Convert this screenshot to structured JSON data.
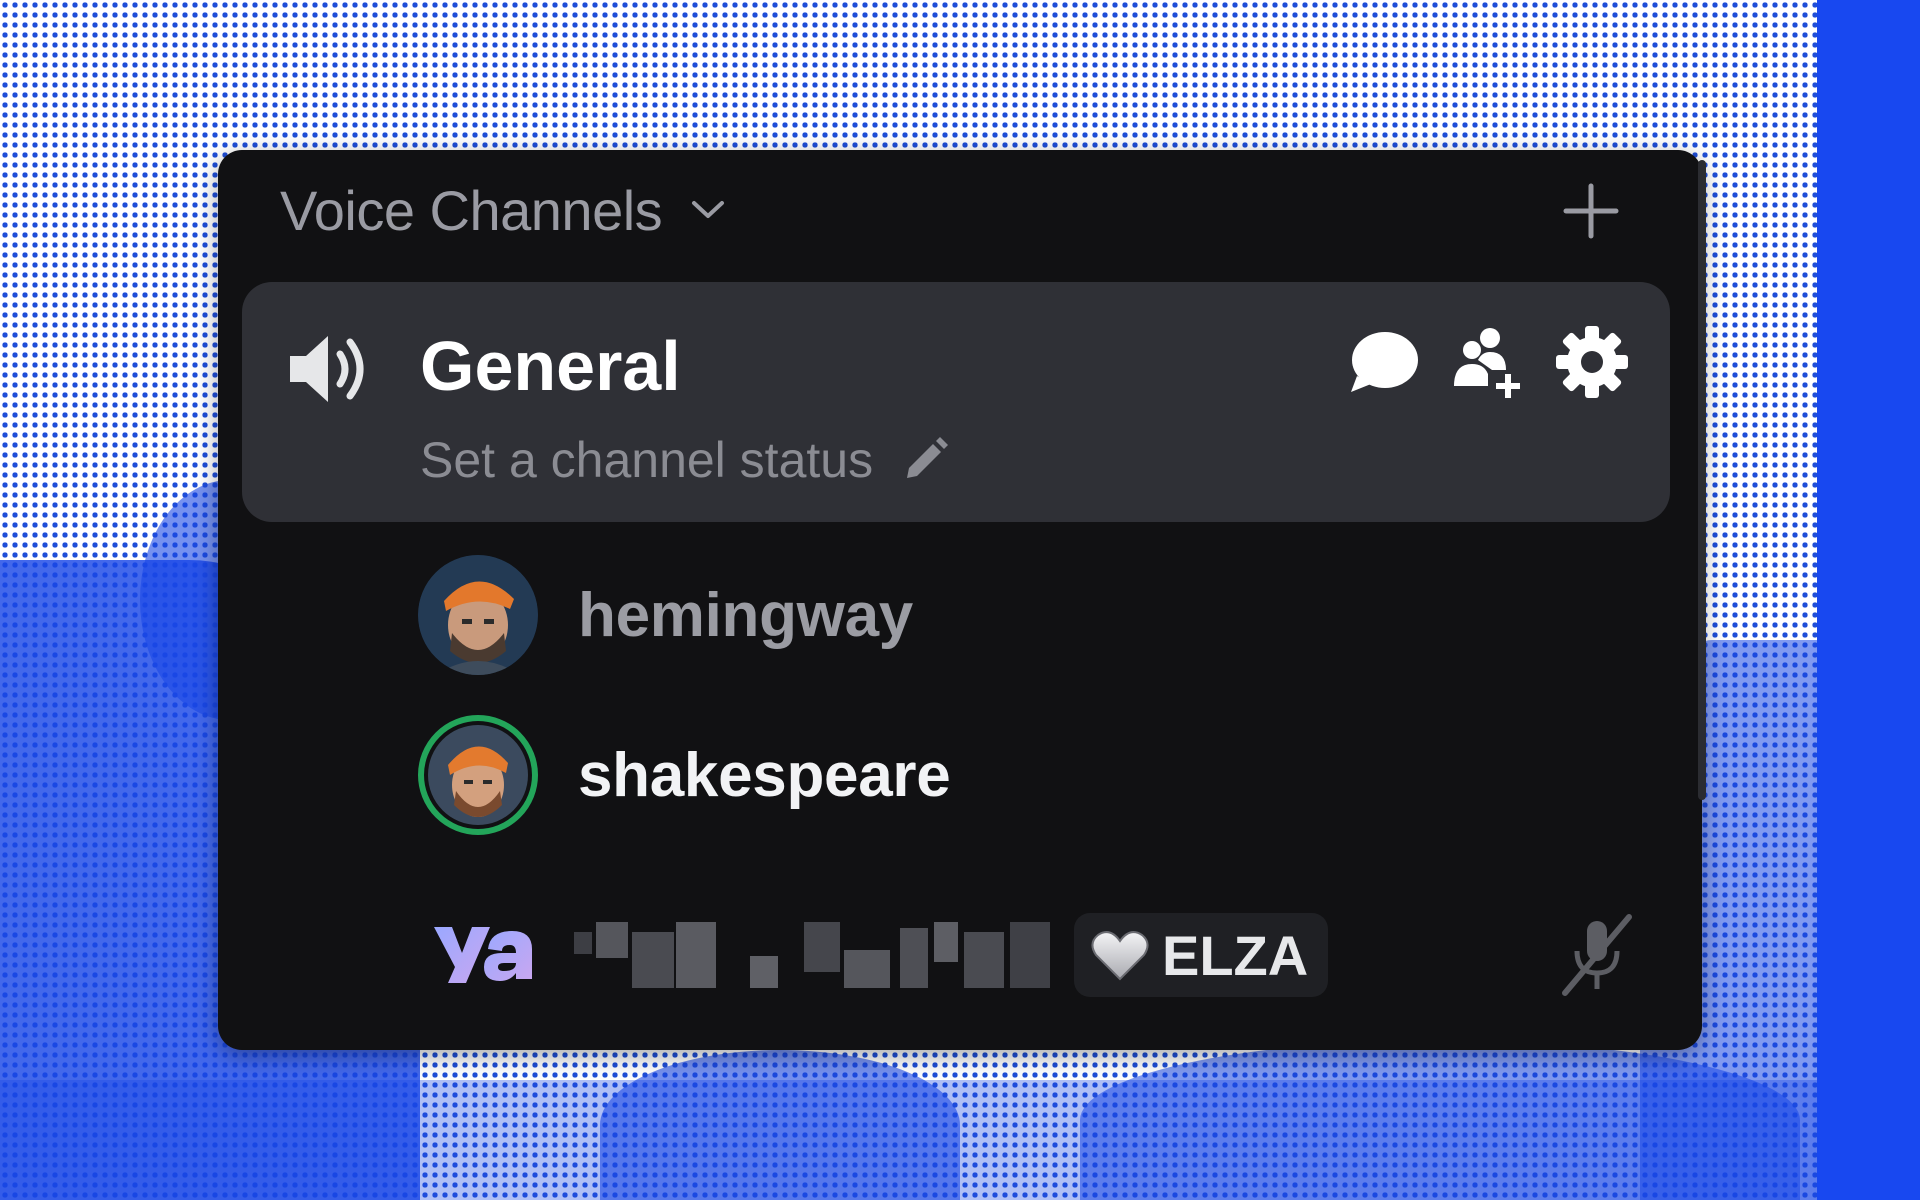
{
  "category": {
    "label": "Voice Channels",
    "chevron_icon": "chevron-down-icon",
    "add_icon": "plus-icon"
  },
  "channel": {
    "name": "General",
    "status_placeholder": "Set a channel status",
    "icons": [
      "speaker-icon",
      "chat-bubble-icon",
      "invite-member-icon",
      "gear-icon",
      "pencil-icon"
    ]
  },
  "members": [
    {
      "name": "hemingway",
      "speaking": false
    },
    {
      "name": "shakespeare",
      "speaking": true
    },
    {
      "tag": "ELZA",
      "name_visible": false,
      "muted": true
    }
  ],
  "colors": {
    "panel_bg": "#111113",
    "channel_bg": "#2f3036",
    "speaking_ring": "#23a55a",
    "background_blue": "#1a47e6"
  }
}
